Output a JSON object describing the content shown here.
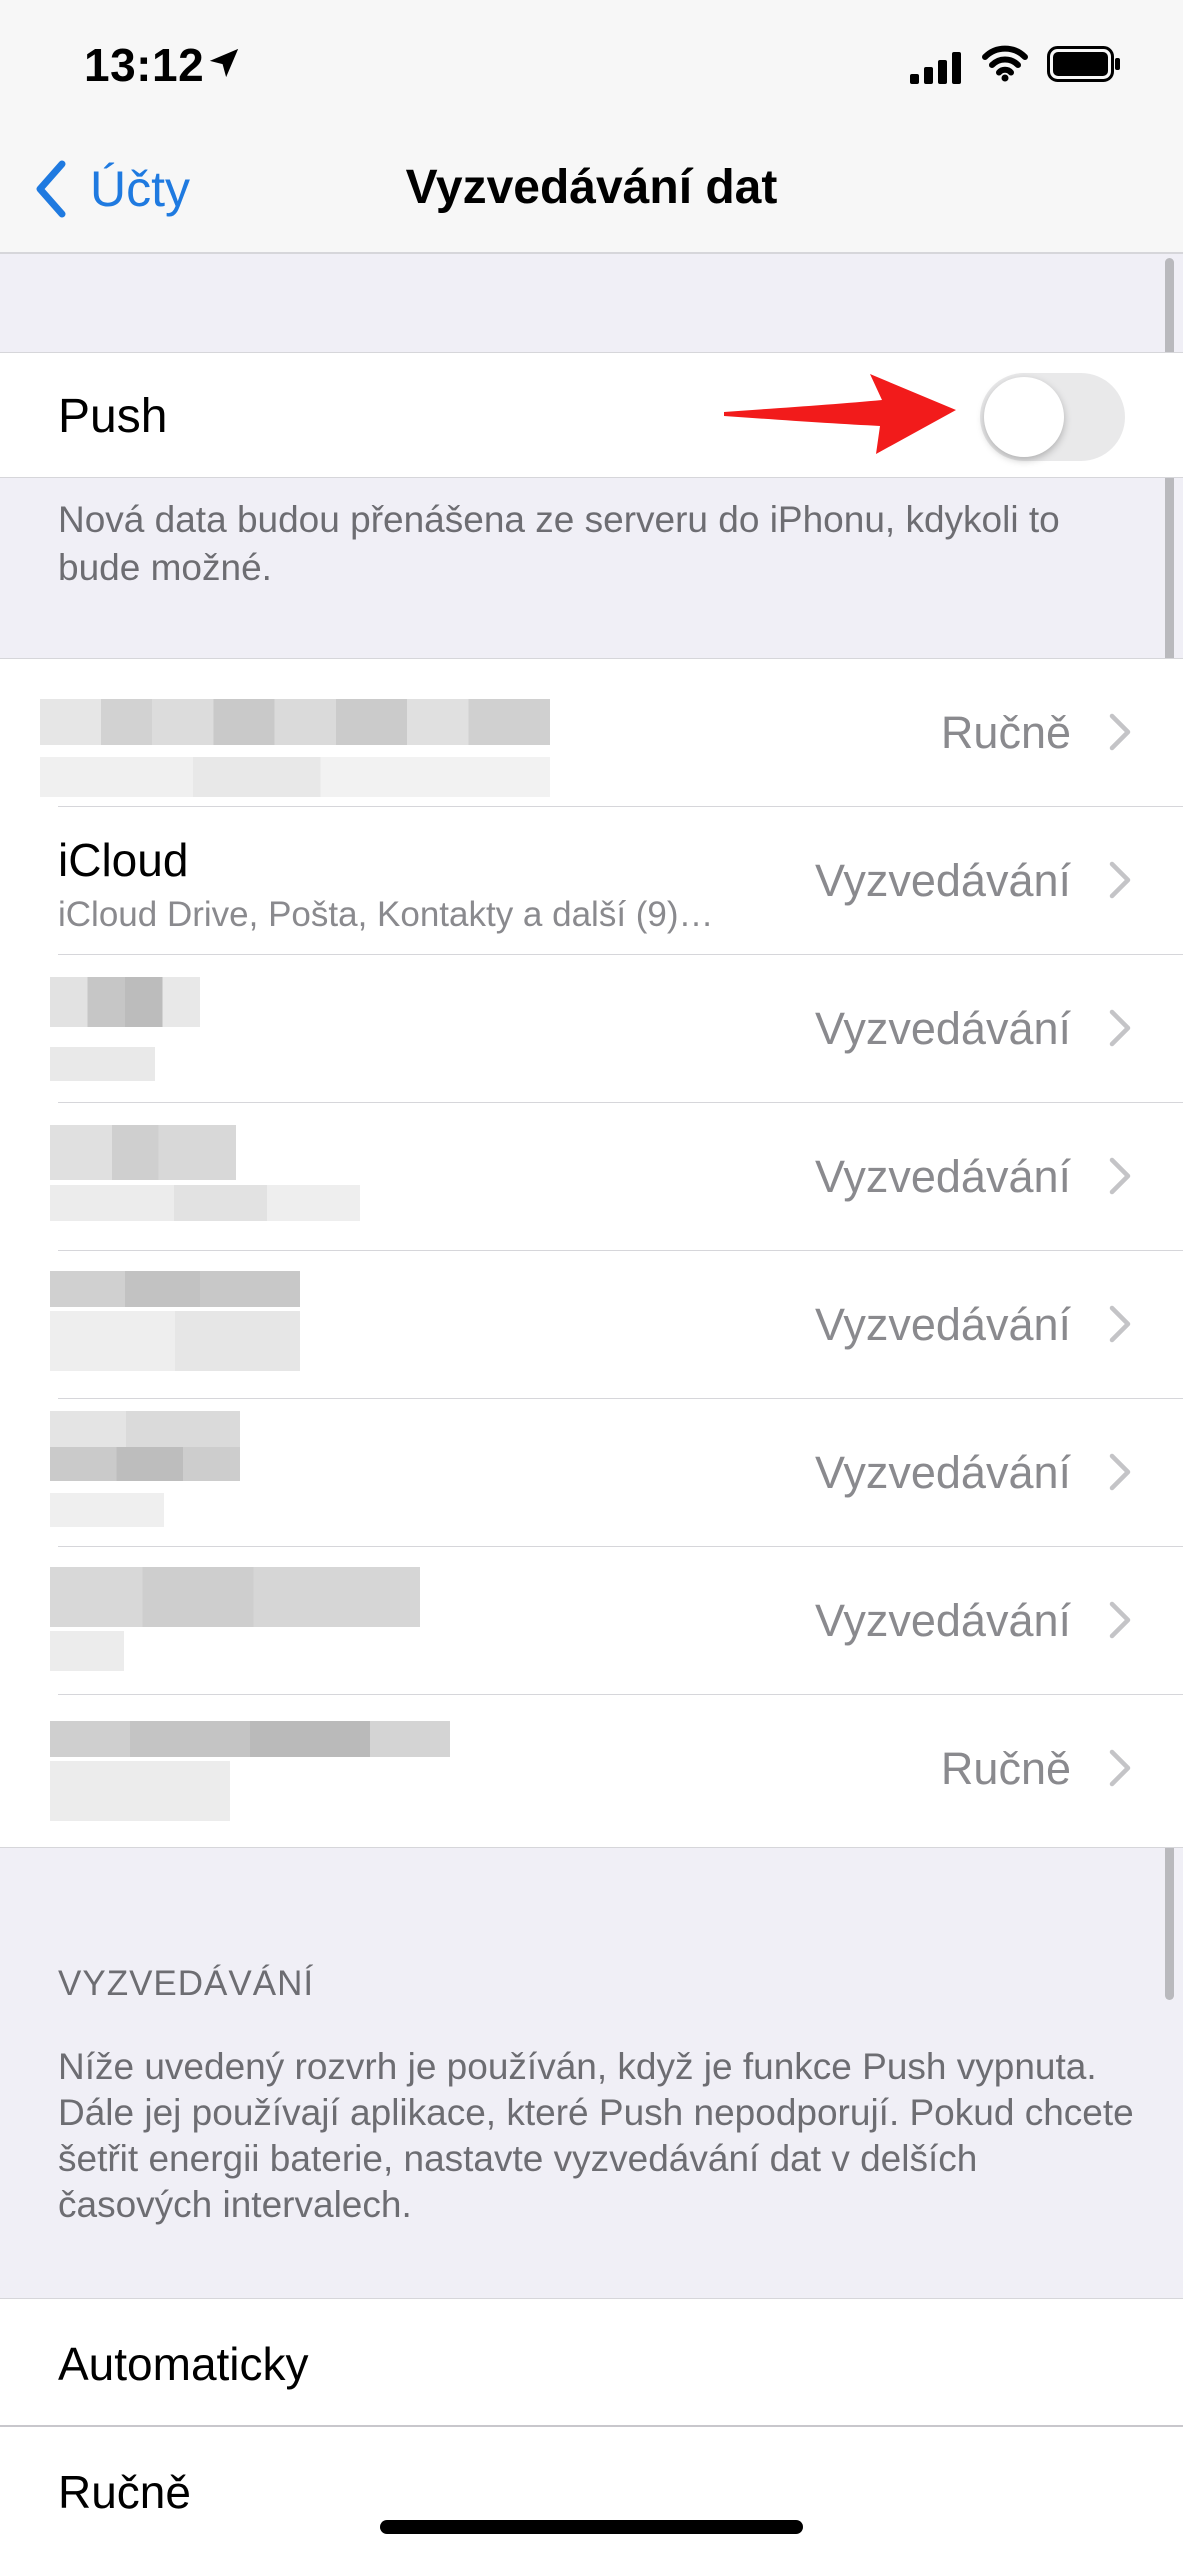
{
  "status": {
    "time": "13:12"
  },
  "nav": {
    "back_label": "Účty",
    "title": "Vyzvedávání dat"
  },
  "push": {
    "label": "Push",
    "enabled": false,
    "footer": "Nová data budou přenášena ze serveru do iPhonu, kdykoli to bude možné."
  },
  "accounts": [
    {
      "title": "",
      "subtitle": "",
      "value": "Ručně",
      "blurred": true
    },
    {
      "title": "iCloud",
      "subtitle": "iCloud Drive, Pošta, Kontakty a další (9)…",
      "value": "Vyzvedávání",
      "blurred": false
    },
    {
      "title": "",
      "subtitle": "",
      "value": "Vyzvedávání",
      "blurred": true
    },
    {
      "title": "",
      "subtitle": "",
      "value": "Vyzvedávání",
      "blurred": true
    },
    {
      "title": "",
      "subtitle": "",
      "value": "Vyzvedávání",
      "blurred": true
    },
    {
      "title": "",
      "subtitle": "",
      "value": "Vyzvedávání",
      "blurred": true
    },
    {
      "title": "",
      "subtitle": "",
      "value": "Vyzvedávání",
      "blurred": true
    },
    {
      "title": "",
      "subtitle": "",
      "value": "Ručně",
      "blurred": true
    }
  ],
  "fetch_section": {
    "header": "VYZVEDÁVÁNÍ",
    "footer": "Níže uvedený rozvrh je používán, když je funkce Push vypnuta. Dále jej používají aplikace, které Push nepodporují. Pokud chcete šetřit energii baterie, nastavte vyzvedávání dat v delších časových intervalech.",
    "options": [
      "Automaticky",
      "Ručně"
    ]
  },
  "colors": {
    "accent": "#1f7ae0",
    "annotation_arrow": "#f21b1b",
    "toggle_off": "#e9e9ea"
  }
}
